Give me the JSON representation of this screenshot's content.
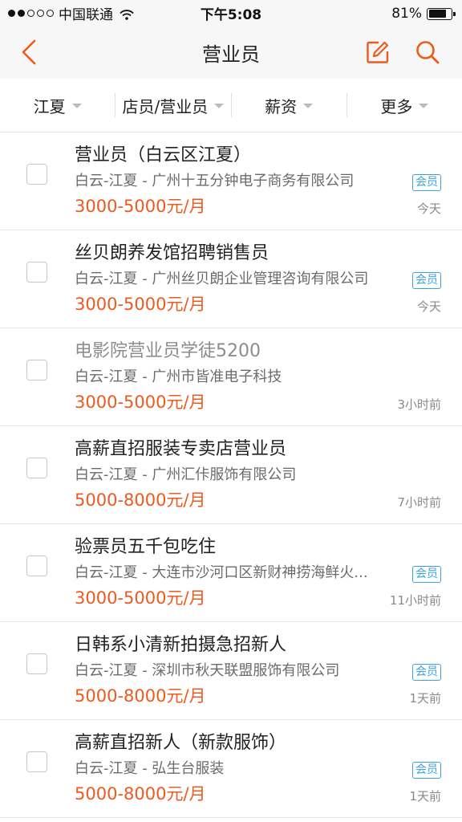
{
  "status_bar": {
    "carrier": "中国联通",
    "time": "下午5:08",
    "battery": "81%",
    "battery_level": 0.81
  },
  "navbar": {
    "title": "营业员",
    "accent_color": "#ee5a1e",
    "icons": [
      "chevron-left-icon",
      "edit-icon",
      "search-icon"
    ]
  },
  "filters": [
    {
      "label": "江夏"
    },
    {
      "label": "店员/营业员"
    },
    {
      "label": "薪资"
    },
    {
      "label": "更多"
    }
  ],
  "jobs": [
    {
      "title": "营业员（白云区江夏）",
      "company": "白云-江夏 - 广州十五分钟电子商务有限公司",
      "salary": "3000-5000元/月",
      "badge": "会员",
      "date": "今天",
      "visited": false
    },
    {
      "title": "丝贝朗养发馆招聘销售员",
      "company": "白云-江夏 - 广州丝贝朗企业管理咨询有限公司",
      "salary": "3000-5000元/月",
      "badge": "会员",
      "date": "今天",
      "visited": false
    },
    {
      "title": "电影院营业员学徒5200",
      "company": "白云-江夏 - 广州市皆准电子科技",
      "salary": "3000-5000元/月",
      "badge": "",
      "date": "3小时前",
      "visited": true
    },
    {
      "title": "高薪直招服装专卖店营业员",
      "company": "白云-江夏 - 广州汇佧服饰有限公司",
      "salary": "5000-8000元/月",
      "badge": "",
      "date": "7小时前",
      "visited": false
    },
    {
      "title": "验票员五千包吃住",
      "company": "白云-江夏 - 大连市沙河口区新财神捞海鲜火...",
      "salary": "3000-5000元/月",
      "badge": "会员",
      "date": "11小时前",
      "visited": false
    },
    {
      "title": "日韩系小清新拍摄急招新人",
      "company": "白云-江夏 - 深圳市秋天联盟服饰有限公司",
      "salary": "5000-8000元/月",
      "badge": "会员",
      "date": "1天前",
      "visited": false
    },
    {
      "title": "高薪直招新人（新款服饰）",
      "company": "白云-江夏 - 弘生台服装",
      "salary": "5000-8000元/月",
      "badge": "会员",
      "date": "1天前",
      "visited": false
    }
  ]
}
